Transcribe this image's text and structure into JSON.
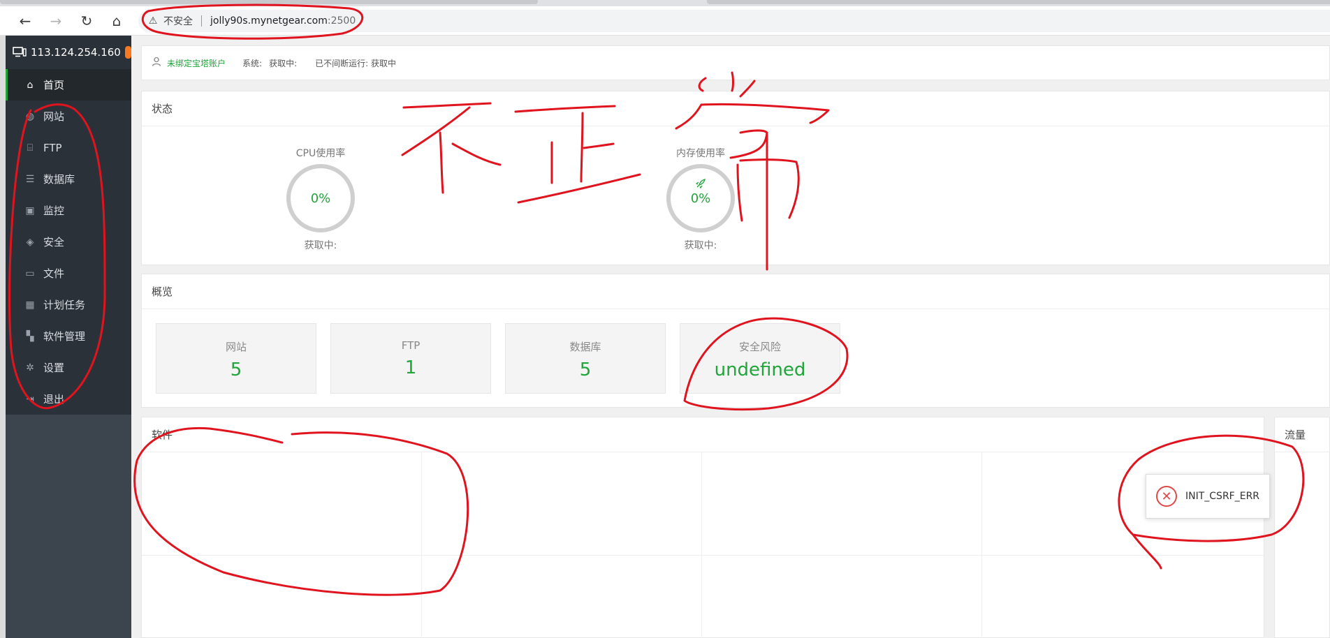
{
  "browser": {
    "back_icon": "←",
    "forward_icon": "→",
    "reload_icon": "↻",
    "home_icon": "⌂",
    "warning_icon": "⚠",
    "insecure_label": "不安全",
    "url_host": "jolly90s.mynetgear.com",
    "url_port": ":2500"
  },
  "sidebar": {
    "server_ip": "113.124.254.160",
    "items": [
      {
        "label": "首页",
        "icon": "⌂"
      },
      {
        "label": "网站",
        "icon": "◍"
      },
      {
        "label": "FTP",
        "icon": "⌸"
      },
      {
        "label": "数据库",
        "icon": "☰"
      },
      {
        "label": "监控",
        "icon": "▣"
      },
      {
        "label": "安全",
        "icon": "◈"
      },
      {
        "label": "文件",
        "icon": "▭"
      },
      {
        "label": "计划任务",
        "icon": "▦"
      },
      {
        "label": "软件管理",
        "icon": "▚"
      },
      {
        "label": "设置",
        "icon": "✲"
      },
      {
        "label": "退出",
        "icon": "⇥"
      }
    ]
  },
  "userbar": {
    "account": "未绑定宝塔账户",
    "system_label": "系统:",
    "system_value": "获取中:",
    "uptime": "已不间断运行: 获取中"
  },
  "status": {
    "title": "状态",
    "cpu": {
      "label": "CPU使用率",
      "value": "0%",
      "sub": "获取中:"
    },
    "mem": {
      "label": "内存使用率",
      "value": "0%",
      "sub": "获取中:"
    }
  },
  "overview": {
    "title": "概览",
    "cards": [
      {
        "label": "网站",
        "value": "5"
      },
      {
        "label": "FTP",
        "value": "1"
      },
      {
        "label": "数据库",
        "value": "5"
      },
      {
        "label": "安全风险",
        "value": "undefined"
      }
    ]
  },
  "software": {
    "title": "软件"
  },
  "traffic": {
    "title": "流量"
  },
  "toast": {
    "message": "INIT_CSRF_ERR",
    "icon": "✕"
  },
  "colors": {
    "accent": "#20a53a",
    "sidebar": "#3c444d",
    "sidebar_dark": "#2b3138",
    "badge": "#f7781f",
    "annotation": "#e0141e",
    "error": "#e04848"
  }
}
